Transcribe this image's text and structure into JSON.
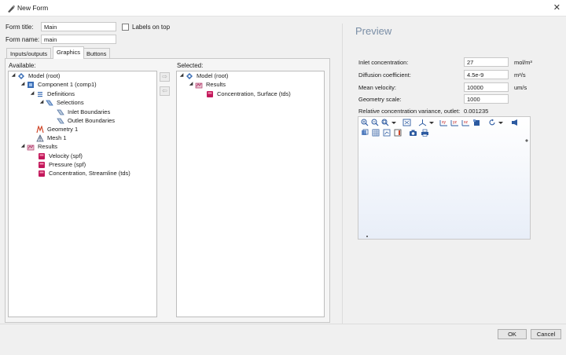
{
  "window": {
    "title": "New Form",
    "close_glyph": "✕"
  },
  "form": {
    "title_label": "Form title:",
    "title_value": "Main",
    "name_label": "Form name:",
    "name_value": "main",
    "labels_on_top": "Labels on top"
  },
  "tabs": [
    {
      "label": "Inputs/outputs"
    },
    {
      "label": "Graphics"
    },
    {
      "label": "Buttons"
    }
  ],
  "available": {
    "heading": "Available:",
    "items": [
      {
        "label": "Model (root)",
        "icon": "model-root-icon"
      },
      {
        "label": "Component 1 (comp1)",
        "icon": "component-icon"
      },
      {
        "label": "Definitions",
        "icon": "definitions-icon"
      },
      {
        "label": "Selections",
        "icon": "selections-icon"
      },
      {
        "label": "Inlet Boundaries",
        "icon": "selection-item-icon"
      },
      {
        "label": "Outlet Boundaries",
        "icon": "selection-item-icon"
      },
      {
        "label": "Geometry 1",
        "icon": "geometry-icon"
      },
      {
        "label": "Mesh 1",
        "icon": "mesh-icon"
      },
      {
        "label": "Results",
        "icon": "results-icon"
      },
      {
        "label": "Velocity (spf)",
        "icon": "plot-group-icon"
      },
      {
        "label": "Pressure (spf)",
        "icon": "plot-group-icon"
      },
      {
        "label": "Concentration, Streamline (tds)",
        "icon": "plot-group-icon"
      }
    ]
  },
  "selected": {
    "heading": "Selected:",
    "items": [
      {
        "label": "Model (root)",
        "icon": "model-root-icon"
      },
      {
        "label": "Results",
        "icon": "results-icon"
      },
      {
        "label": "Concentration, Surface (tds)",
        "icon": "plot-group-icon"
      }
    ]
  },
  "move_buttons": {
    "add": "⇨",
    "remove": "⇦"
  },
  "preview": {
    "title": "Preview",
    "fields": [
      {
        "label": "Inlet concentration:",
        "value": "27",
        "unit": "mol/m³"
      },
      {
        "label": "Diffusion coefficient:",
        "value": "4.5e-9",
        "unit": "m²/s"
      },
      {
        "label": "Mean velocity:",
        "value": "10000",
        "unit": "um/s"
      },
      {
        "label": "Geometry scale:",
        "value": "1000",
        "unit": ""
      }
    ],
    "variance_label": "Relative concentration variance, outlet:",
    "variance_value": "0.001235"
  },
  "buttons": {
    "ok": "OK",
    "cancel": "Cancel"
  },
  "colors": {
    "accent": "#7a8ea6",
    "plot_group": "#c2185b",
    "model_root": "#3a6db5"
  }
}
